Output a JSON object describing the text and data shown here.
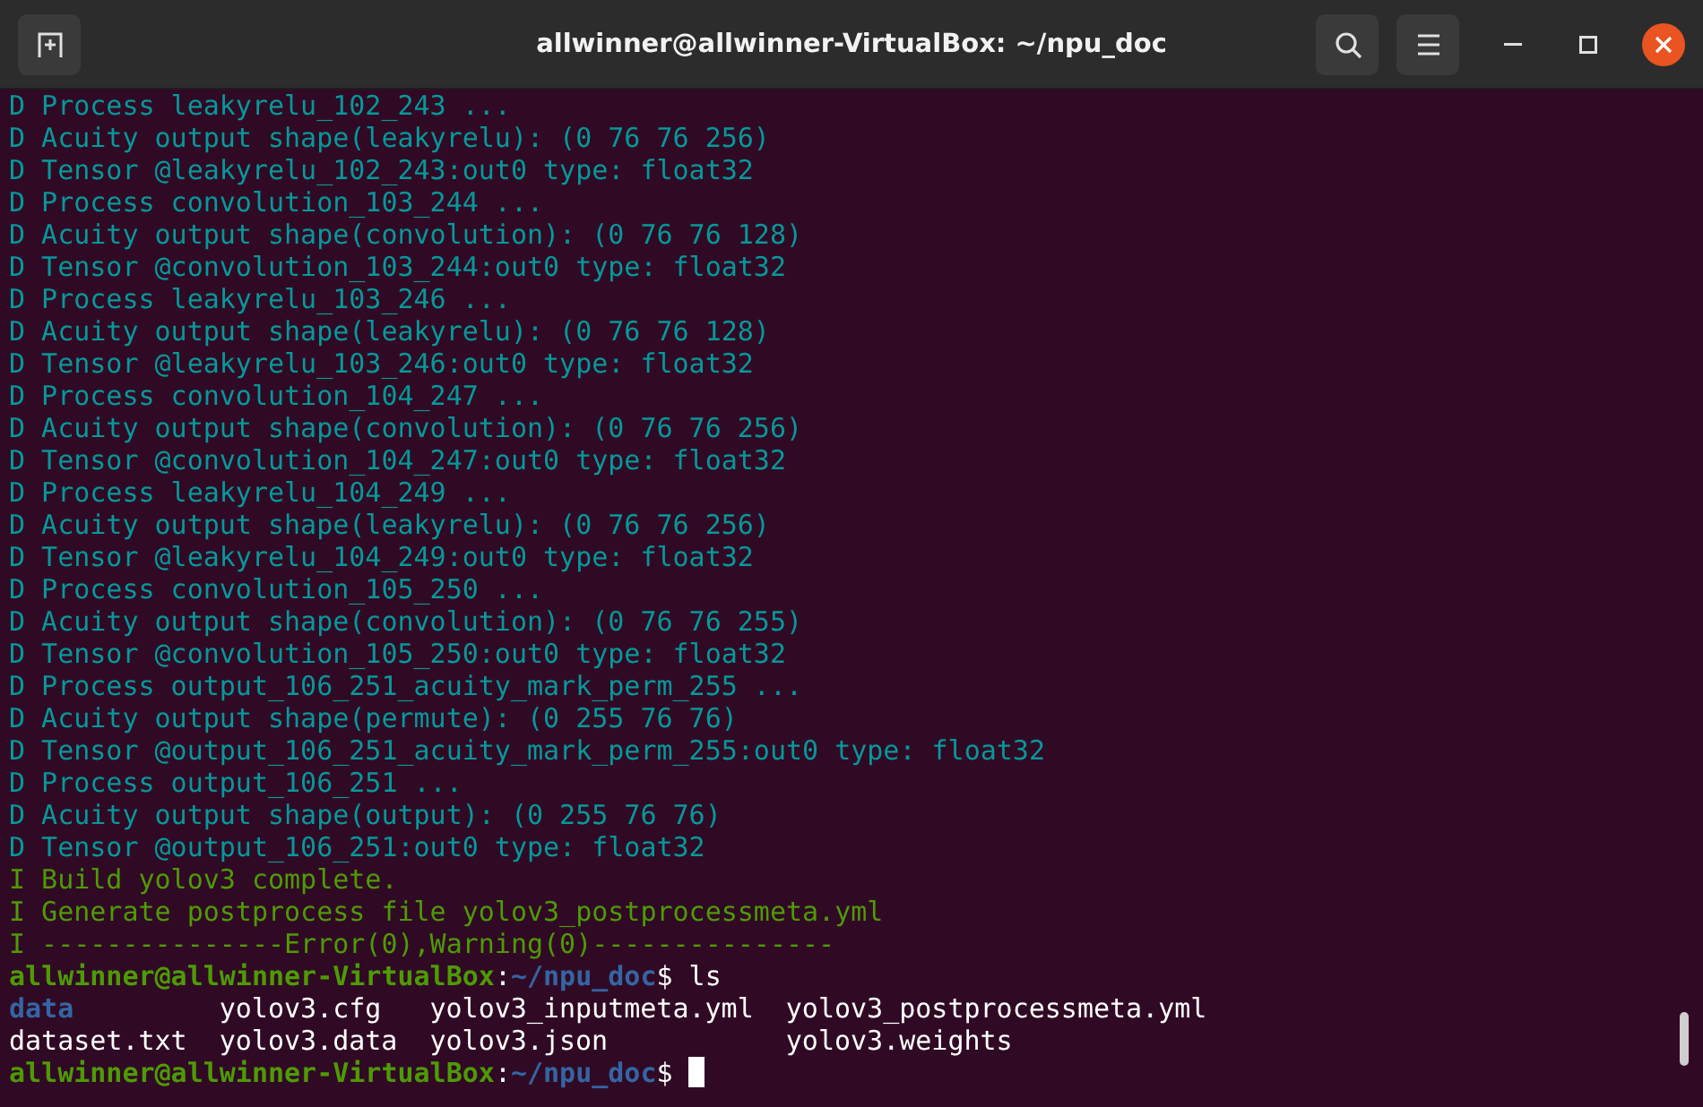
{
  "window": {
    "title": "allwinner@allwinner-VirtualBox: ~/npu_doc"
  },
  "terminal": {
    "lines": [
      {
        "kind": "debug",
        "text": "D Process leakyrelu_102_243 ..."
      },
      {
        "kind": "debug",
        "text": "D Acuity output shape(leakyrelu): (0 76 76 256)"
      },
      {
        "kind": "debug",
        "text": "D Tensor @leakyrelu_102_243:out0 type: float32"
      },
      {
        "kind": "debug",
        "text": "D Process convolution_103_244 ..."
      },
      {
        "kind": "debug",
        "text": "D Acuity output shape(convolution): (0 76 76 128)"
      },
      {
        "kind": "debug",
        "text": "D Tensor @convolution_103_244:out0 type: float32"
      },
      {
        "kind": "debug",
        "text": "D Process leakyrelu_103_246 ..."
      },
      {
        "kind": "debug",
        "text": "D Acuity output shape(leakyrelu): (0 76 76 128)"
      },
      {
        "kind": "debug",
        "text": "D Tensor @leakyrelu_103_246:out0 type: float32"
      },
      {
        "kind": "debug",
        "text": "D Process convolution_104_247 ..."
      },
      {
        "kind": "debug",
        "text": "D Acuity output shape(convolution): (0 76 76 256)"
      },
      {
        "kind": "debug",
        "text": "D Tensor @convolution_104_247:out0 type: float32"
      },
      {
        "kind": "debug",
        "text": "D Process leakyrelu_104_249 ..."
      },
      {
        "kind": "debug",
        "text": "D Acuity output shape(leakyrelu): (0 76 76 256)"
      },
      {
        "kind": "debug",
        "text": "D Tensor @leakyrelu_104_249:out0 type: float32"
      },
      {
        "kind": "debug",
        "text": "D Process convolution_105_250 ..."
      },
      {
        "kind": "debug",
        "text": "D Acuity output shape(convolution): (0 76 76 255)"
      },
      {
        "kind": "debug",
        "text": "D Tensor @convolution_105_250:out0 type: float32"
      },
      {
        "kind": "debug",
        "text": "D Process output_106_251_acuity_mark_perm_255 ..."
      },
      {
        "kind": "debug",
        "text": "D Acuity output shape(permute): (0 255 76 76)"
      },
      {
        "kind": "debug",
        "text": "D Tensor @output_106_251_acuity_mark_perm_255:out0 type: float32"
      },
      {
        "kind": "debug",
        "text": "D Process output_106_251 ..."
      },
      {
        "kind": "debug",
        "text": "D Acuity output shape(output): (0 255 76 76)"
      },
      {
        "kind": "debug",
        "text": "D Tensor @output_106_251:out0 type: float32"
      },
      {
        "kind": "info",
        "text": "I Build yolov3 complete."
      },
      {
        "kind": "info",
        "text": "I Generate postprocess file yolov3_postprocessmeta.yml"
      },
      {
        "kind": "info",
        "text": "I ---------------Error(0),Warning(0)---------------"
      },
      {
        "kind": "prompt",
        "user_host": "allwinner@allwinner-VirtualBox",
        "separator": ":",
        "path": "~/npu_doc",
        "symbol": "$",
        "command": "ls",
        "cursor": false
      },
      {
        "kind": "listing",
        "entries": [
          {
            "name": "data",
            "kind": "directory"
          },
          {
            "name": "yolov3.cfg",
            "kind": "file"
          },
          {
            "name": "yolov3_inputmeta.yml",
            "kind": "file"
          },
          {
            "name": "yolov3_postprocessmeta.yml",
            "kind": "file"
          }
        ]
      },
      {
        "kind": "listing",
        "entries": [
          {
            "name": "dataset.txt",
            "kind": "file"
          },
          {
            "name": "yolov3.data",
            "kind": "file"
          },
          {
            "name": "yolov3.json",
            "kind": "file"
          },
          {
            "name": "yolov3.weights",
            "kind": "file"
          }
        ]
      },
      {
        "kind": "prompt",
        "user_host": "allwinner@allwinner-VirtualBox",
        "separator": ":",
        "path": "~/npu_doc",
        "symbol": "$",
        "cursor": true
      }
    ]
  }
}
